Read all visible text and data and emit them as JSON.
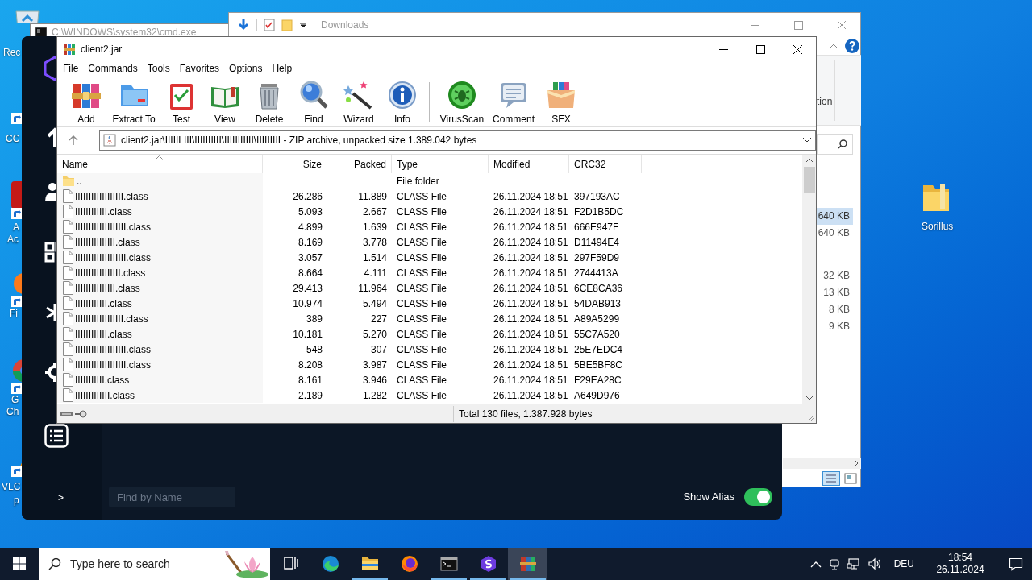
{
  "desktop": {
    "icons": [
      {
        "kind": "recycle",
        "lines": [
          "Rec"
        ]
      },
      {
        "kind": "shortcut",
        "lines": [
          "CC"
        ]
      },
      {
        "kind": "acrobat",
        "lines": [
          "A",
          "Ac"
        ]
      },
      {
        "kind": "firefox",
        "lines": [
          "Fi"
        ]
      },
      {
        "kind": "chrome",
        "lines": [
          "G",
          "Ch"
        ]
      },
      {
        "kind": "vlc",
        "lines": [
          "VLC",
          "p"
        ]
      },
      {
        "kind": "folder",
        "lines": [
          "Sorillus"
        ]
      }
    ]
  },
  "cmd_window": {
    "title": "C:\\WINDOWS\\system32\\cmd.exe"
  },
  "explorer": {
    "title": "Downloads",
    "ribbon_text": "tion",
    "sizes_top": [
      {
        "text": "640 KB",
        "selected": true
      },
      {
        "text": "640 KB",
        "selected": false
      }
    ],
    "sizes_bottom": [
      {
        "text": "32 KB",
        "selected": false
      },
      {
        "text": "13 KB",
        "selected": false
      },
      {
        "text": "8 KB",
        "selected": false
      },
      {
        "text": "9 KB",
        "selected": false
      }
    ]
  },
  "dark_app": {
    "prompt": ">",
    "search": {
      "placeholder": "Find by Name"
    },
    "show_alias": {
      "label": "Show Alias",
      "on": true
    }
  },
  "winrar": {
    "title": "client2.jar",
    "menu": [
      "File",
      "Commands",
      "Tools",
      "Favorites",
      "Options",
      "Help"
    ],
    "toolbar": [
      {
        "kind": "add",
        "label": "Add"
      },
      {
        "kind": "extract",
        "label": "Extract To"
      },
      {
        "kind": "test",
        "label": "Test"
      },
      {
        "kind": "view",
        "label": "View"
      },
      {
        "kind": "delete",
        "label": "Delete"
      },
      {
        "kind": "find",
        "label": "Find"
      },
      {
        "kind": "wizard",
        "label": "Wizard"
      },
      {
        "kind": "info",
        "label": "Info"
      },
      {
        "kind": "separator"
      },
      {
        "kind": "virusscan",
        "label": "VirusScan"
      },
      {
        "kind": "comment",
        "label": "Comment"
      },
      {
        "kind": "sfx",
        "label": "SFX"
      }
    ],
    "path": "client2.jar\\IIIIILIII\\IIIIIIIIII\\IIIIIIIIIII\\IIIIIIIII - ZIP archive, unpacked size 1.389.042 bytes",
    "columns": [
      {
        "label": "Name",
        "sorted": true
      },
      {
        "label": "Size",
        "sorted": false
      },
      {
        "label": "Packed",
        "sorted": false
      },
      {
        "label": "Type",
        "sorted": false
      },
      {
        "label": "Modified",
        "sorted": false
      },
      {
        "label": "CRC32",
        "sorted": false
      }
    ],
    "rows": [
      {
        "kind": "folder",
        "name": "..",
        "type": "File folder"
      },
      {
        "kind": "file",
        "name": "IIIIIIIIIIIIIIIIII.class",
        "size": "26.286",
        "packed": "11.889",
        "type": "CLASS File",
        "modified": "26.11.2024 18:51",
        "crc32": "397193AC"
      },
      {
        "kind": "file",
        "name": "IIIIIIIIIIII.class",
        "size": "5.093",
        "packed": "2.667",
        "type": "CLASS File",
        "modified": "26.11.2024 18:51",
        "crc32": "F2D1B5DC"
      },
      {
        "kind": "file",
        "name": "IIIIIIIIIIIIIIIIIII.class",
        "size": "4.899",
        "packed": "1.639",
        "type": "CLASS File",
        "modified": "26.11.2024 18:51",
        "crc32": "666E947F"
      },
      {
        "kind": "file",
        "name": "IIIIIIIIIIIIIII.class",
        "size": "8.169",
        "packed": "3.778",
        "type": "CLASS File",
        "modified": "26.11.2024 18:51",
        "crc32": "D11494E4"
      },
      {
        "kind": "file",
        "name": "IIIIIIIIIIIIIIIIIII.class",
        "size": "3.057",
        "packed": "1.514",
        "type": "CLASS File",
        "modified": "26.11.2024 18:51",
        "crc32": "297F59D9"
      },
      {
        "kind": "file",
        "name": "IIIIIIIIIIIIIIIII.class",
        "size": "8.664",
        "packed": "4.111",
        "type": "CLASS File",
        "modified": "26.11.2024 18:51",
        "crc32": "2744413A"
      },
      {
        "kind": "file",
        "name": "IIIIIIIIIIIIIII.class",
        "size": "29.413",
        "packed": "11.964",
        "type": "CLASS File",
        "modified": "26.11.2024 18:51",
        "crc32": "6CE8CA36"
      },
      {
        "kind": "file",
        "name": "IIIIIIIIIIII.class",
        "size": "10.974",
        "packed": "5.494",
        "type": "CLASS File",
        "modified": "26.11.2024 18:51",
        "crc32": "54DAB913"
      },
      {
        "kind": "file",
        "name": "IIIIIIIIIIIIIIIIII.class",
        "size": "389",
        "packed": "227",
        "type": "CLASS File",
        "modified": "26.11.2024 18:51",
        "crc32": "A89A5299"
      },
      {
        "kind": "file",
        "name": "IIIIIIIIIIII.class",
        "size": "10.181",
        "packed": "5.270",
        "type": "CLASS File",
        "modified": "26.11.2024 18:51",
        "crc32": "55C7A520"
      },
      {
        "kind": "file",
        "name": "IIIIIIIIIIIIIIIIIII.class",
        "size": "548",
        "packed": "307",
        "type": "CLASS File",
        "modified": "26.11.2024 18:51",
        "crc32": "25E7EDC4"
      },
      {
        "kind": "file",
        "name": "IIIIIIIIIIIIIIIIIII.class",
        "size": "8.208",
        "packed": "3.987",
        "type": "CLASS File",
        "modified": "26.11.2024 18:51",
        "crc32": "5BE5BF8C"
      },
      {
        "kind": "file",
        "name": "IIIIIIIIIII.class",
        "size": "8.161",
        "packed": "3.946",
        "type": "CLASS File",
        "modified": "26.11.2024 18:51",
        "crc32": "F29EA28C"
      },
      {
        "kind": "file",
        "name": "IIIIIIIIIIIII.class",
        "size": "2.189",
        "packed": "1.282",
        "type": "CLASS File",
        "modified": "26.11.2024 18:51",
        "crc32": "A649D976"
      }
    ],
    "status": "Total 130 files, 1.387.928 bytes"
  },
  "taskbar": {
    "search_placeholder": "Type here to search",
    "apps": [
      {
        "kind": "taskview",
        "running": false,
        "active": false
      },
      {
        "kind": "edge",
        "running": false,
        "active": false
      },
      {
        "kind": "explorer",
        "running": true,
        "active": false
      },
      {
        "kind": "firefox",
        "running": false,
        "active": false
      },
      {
        "kind": "cmd",
        "running": true,
        "active": false
      },
      {
        "kind": "sorillus",
        "running": true,
        "active": false
      },
      {
        "kind": "winrar",
        "running": true,
        "active": true
      }
    ],
    "language": "DEU",
    "time": "18:54",
    "date": "26.11.2024"
  }
}
